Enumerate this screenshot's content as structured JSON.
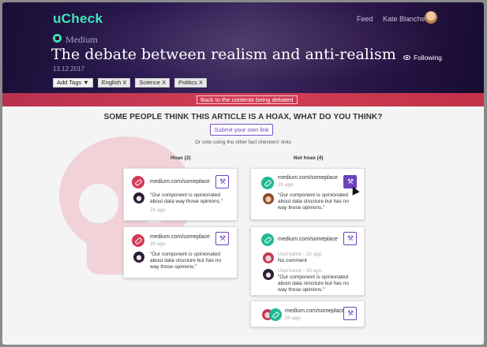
{
  "app": {
    "logo": "uCheck"
  },
  "nav": {
    "feed": "Feed",
    "user": "Kate Blanchett"
  },
  "article": {
    "source": "Medium",
    "title": "The debate between realism and anti-realism",
    "date": "13.12.2017",
    "following": "Following"
  },
  "tags": {
    "add": "Add Tags ▼",
    "items": [
      "English X",
      "Science X",
      "Politics X"
    ]
  },
  "back_label": "Back to the contents being debated",
  "question": "SOME PEOPLE THINK THIS ARTICLE IS A HOAX, WHAT DO YOU THINK?",
  "submit_label": "Submit your own link",
  "or_vote": "Or vote using the other fact checkers' links",
  "columns": {
    "hoax": "Hoax (2)",
    "not_hoax": "Not hoax (4)"
  },
  "cards": {
    "h1": {
      "url": "medium.com/someplace",
      "quote": "\"Our component is opinionated about data way those opinions.\"",
      "time": "2h ago"
    },
    "h2": {
      "url": "medium.com/someplace",
      "time": "2h ago",
      "quote": "\"Our component is opinionated about data structure but has no way those opinions.\""
    },
    "n1": {
      "url": "medium.com/someplace",
      "time": "2h ago",
      "quote": "\"Our component is opinionated about data structure but has no way those opinions.\""
    },
    "n2": {
      "url": "medium.com/someplace",
      "meta1": "Username - 2h ago",
      "comment1": "No comment",
      "meta2": "Username - 3h ago",
      "quote2": "\"Our component is opinionated about data structure but has no way those opinions.\""
    },
    "n3": {
      "url": "medium.com/someplace",
      "time": "3h ago"
    }
  },
  "colors": {
    "accent": "#6b43bf",
    "brand": "#3ee8b6",
    "hoax": "#d23a57",
    "not_hoax": "#1fb892"
  }
}
